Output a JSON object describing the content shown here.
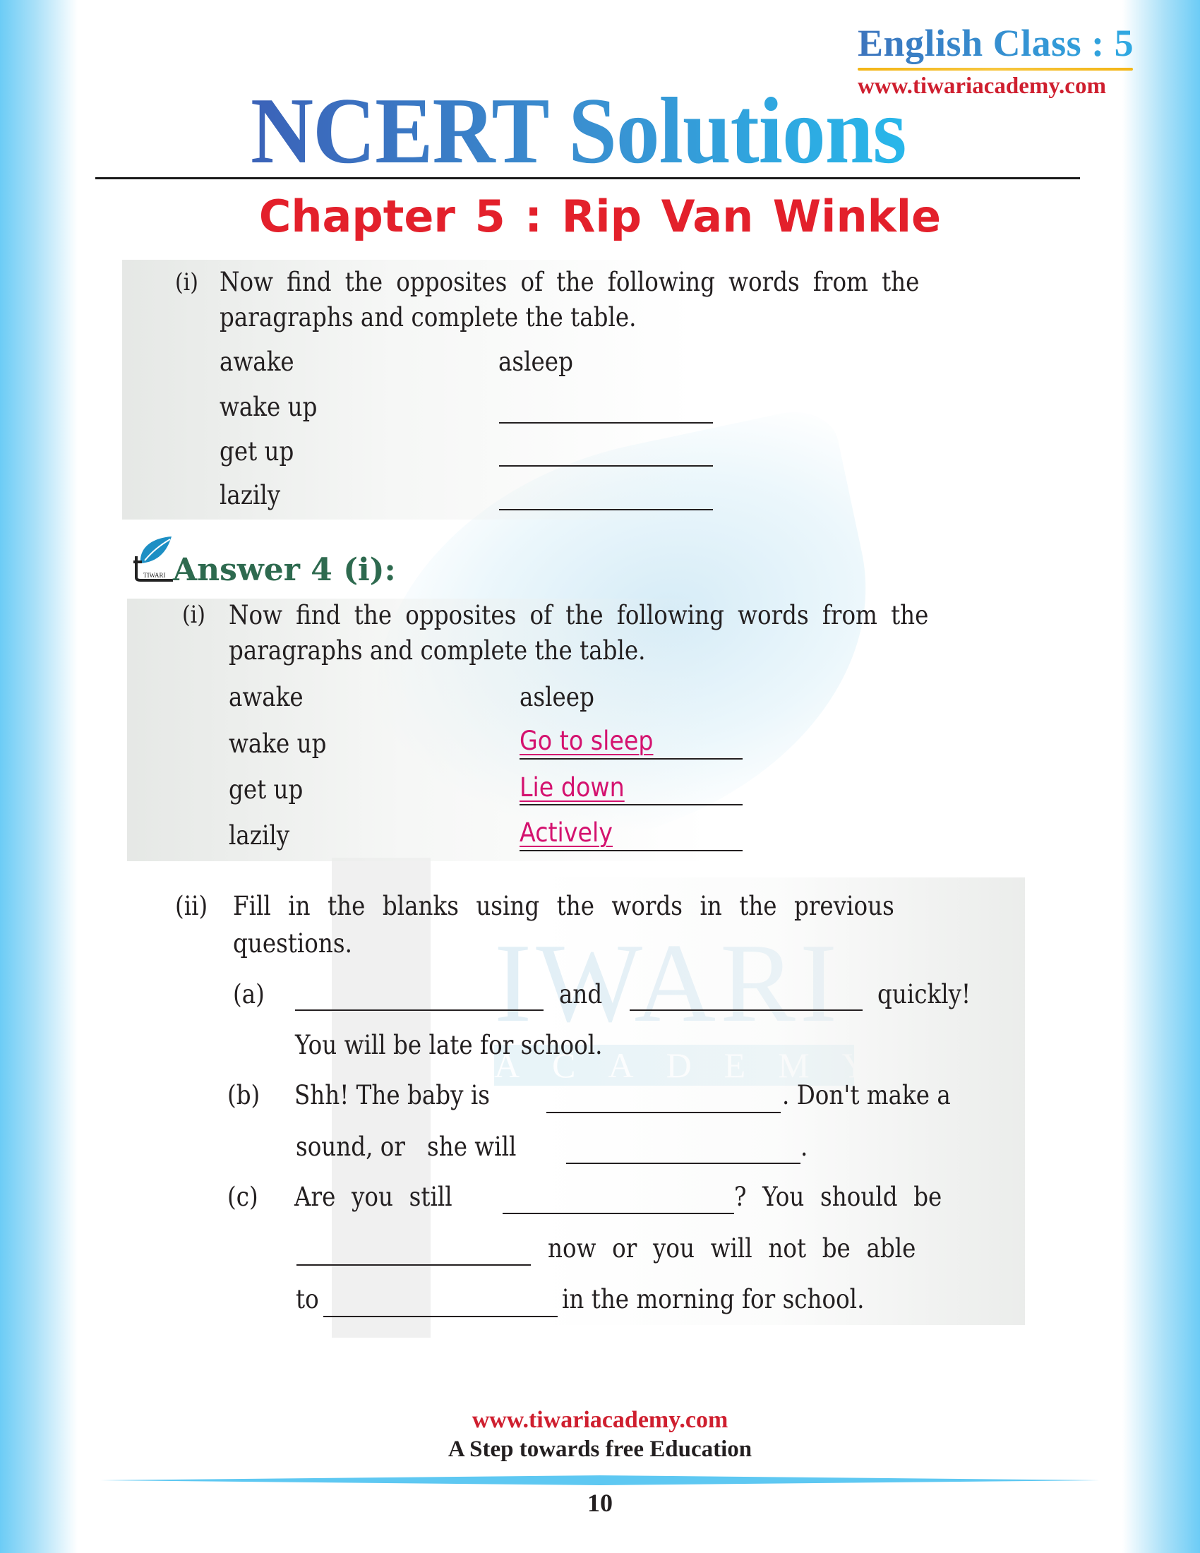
{
  "header": {
    "subject_class": "English Class : 5",
    "website": "www.tiwariacademy.com",
    "title": "NCERT Solutions",
    "chapter": "Chapter 5 :  Rip Van Winkle"
  },
  "watermark": {
    "word": "IWARI",
    "sub": "ACADEMY"
  },
  "question": {
    "label": "(i)",
    "line1": "Now find the opposites of the following words from the",
    "line2": "paragraphs and complete the table.",
    "rows": [
      {
        "word": "awake",
        "opposite": "asleep"
      },
      {
        "word": "wake up",
        "opposite": ""
      },
      {
        "word": "get up",
        "opposite": ""
      },
      {
        "word": "lazily",
        "opposite": ""
      }
    ]
  },
  "answer": {
    "logo_text": "TIWARI",
    "heading": "Answer 4 (i):",
    "label": "(i)",
    "line1": "Now find the opposites of the following words from the",
    "line2": "paragraphs and complete the table.",
    "rows": [
      {
        "word": "awake",
        "opposite": "asleep"
      },
      {
        "word": "wake up",
        "opposite": "Go to sleep"
      },
      {
        "word": "get up",
        "opposite": "Lie down"
      },
      {
        "word": "lazily",
        "opposite": "Actively"
      }
    ],
    "answer_color": "#d4126f"
  },
  "fill_blanks": {
    "label": "(ii)",
    "line1": "Fill in the blanks using the words in the previous",
    "line2": "questions.",
    "a": {
      "label": "(a)",
      "mid": "and",
      "end": "quickly!",
      "line2": "You will be late for school."
    },
    "b": {
      "label": "(b)",
      "start": "Shh! The baby is",
      "end": ". Don't make a",
      "line2_start": "sound, or   she will",
      "line2_end": "."
    },
    "c": {
      "label": "(c)",
      "start": "Are you still",
      "end": "? You should be",
      "line2_end": "now or you will not be able",
      "line3_start": "to",
      "line3_end": "in the morning for school."
    }
  },
  "footer": {
    "website": "www.tiwariacademy.com",
    "tagline": "A Step towards free Education",
    "page_number": "10"
  }
}
